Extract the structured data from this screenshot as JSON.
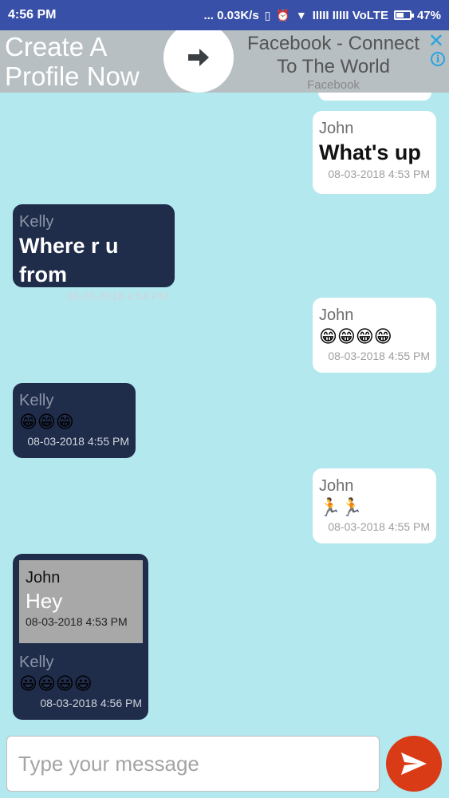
{
  "status_bar": {
    "time": "4:56 PM",
    "network_speed": "... 0.03K/s",
    "signal_text": "IIIII IIIII VoLTE",
    "battery": "47%"
  },
  "ad": {
    "left_text_line1": "Create A",
    "left_text_line2": "Profile Now",
    "right_title_line1": "Facebook - Connect",
    "right_title_line2": "To The World",
    "right_sub": "Facebook",
    "close_glyph": "✕",
    "info_glyph": "i"
  },
  "messages": [
    {
      "sender": "John",
      "text": "What's up",
      "time": "08-03-2018 4:53 PM"
    },
    {
      "sender": "Kelly",
      "text": "Where r u from",
      "time": "08-03-2018 4:54 PM"
    },
    {
      "sender": "John",
      "text": "😁😁😁😁",
      "time": "08-03-2018 4:55 PM"
    },
    {
      "sender": "Kelly",
      "text": "😁😁😁",
      "time": "08-03-2018 4:55 PM"
    },
    {
      "sender": "John",
      "text": "🏃🏃",
      "time": "08-03-2018 4:55 PM"
    },
    {
      "sender": "Kelly",
      "text": "😃😃😃😃",
      "time": "08-03-2018 4:56 PM",
      "quote": {
        "sender": "John",
        "text": "Hey",
        "time": "08-03-2018 4:53 PM"
      }
    }
  ],
  "composer": {
    "placeholder": "Type your message"
  },
  "colors": {
    "status_bar": "#3950a8",
    "background": "#b3e8ee",
    "incoming_bubble": "#1f2c4a",
    "outgoing_bubble": "#ffffff",
    "send_button": "#d93b17"
  },
  "icons": {
    "ad_arrow": "arrow-right-icon",
    "send": "send-icon"
  }
}
